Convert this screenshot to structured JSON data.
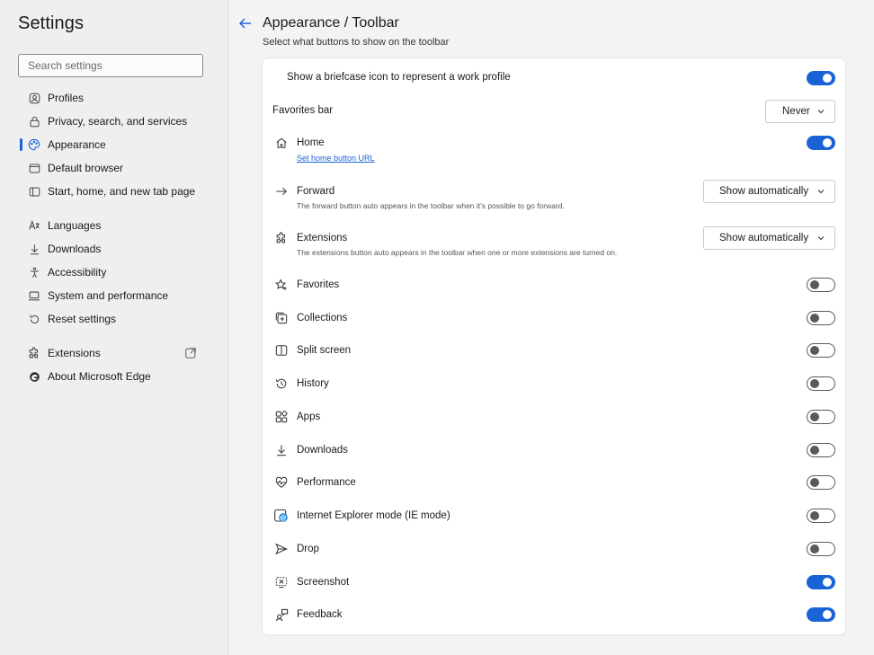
{
  "sidebar": {
    "title": "Settings",
    "search_placeholder": "Search settings",
    "items": [
      {
        "label": "Profiles",
        "icon": "profile-icon"
      },
      {
        "label": "Privacy, search, and services",
        "icon": "lock-icon"
      },
      {
        "label": "Appearance",
        "icon": "palette-icon",
        "active": true
      },
      {
        "label": "Default browser",
        "icon": "browser-icon"
      },
      {
        "label": "Start, home, and new tab page",
        "icon": "home-tab-icon"
      },
      {
        "label": "Languages",
        "icon": "languages-icon"
      },
      {
        "label": "Downloads",
        "icon": "download-icon"
      },
      {
        "label": "Accessibility",
        "icon": "accessibility-icon"
      },
      {
        "label": "System and performance",
        "icon": "laptop-icon"
      },
      {
        "label": "Reset settings",
        "icon": "reset-icon"
      },
      {
        "label": "Extensions",
        "icon": "puzzle-icon"
      },
      {
        "label": "About Microsoft Edge",
        "icon": "edge-logo-icon"
      }
    ]
  },
  "header": {
    "title": "Appearance / Toolbar",
    "subtitle": "Select what buttons to show on the toolbar"
  },
  "settings": {
    "briefcase": {
      "label": "Show a briefcase icon to represent a work profile",
      "toggle": "on"
    },
    "favorites_bar": {
      "label": "Favorites bar",
      "value": "Never"
    },
    "home": {
      "label": "Home",
      "link": "Set home button URL",
      "toggle": "on"
    },
    "forward": {
      "label": "Forward",
      "desc": "The forward button auto appears in the toolbar when it's possible to go forward.",
      "value": "Show automatically"
    },
    "extensions": {
      "label": "Extensions",
      "desc": "The extensions button auto appears in the toolbar when one or more extensions are turned on.",
      "value": "Show automatically"
    },
    "favorites": {
      "label": "Favorites",
      "toggle": "off"
    },
    "collections": {
      "label": "Collections",
      "toggle": "off"
    },
    "split_screen": {
      "label": "Split screen",
      "toggle": "off"
    },
    "history": {
      "label": "History",
      "toggle": "off"
    },
    "apps": {
      "label": "Apps",
      "toggle": "off"
    },
    "downloads": {
      "label": "Downloads",
      "toggle": "off"
    },
    "performance": {
      "label": "Performance",
      "toggle": "off"
    },
    "ie_mode": {
      "label": "Internet Explorer mode (IE mode)",
      "toggle": "off"
    },
    "drop": {
      "label": "Drop",
      "toggle": "off"
    },
    "screenshot": {
      "label": "Screenshot",
      "toggle": "on"
    },
    "feedback": {
      "label": "Feedback",
      "toggle": "on"
    }
  },
  "colors": {
    "accent": "#1a63d6",
    "sidebar_bg": "#efefef",
    "card_bg": "#ffffff"
  }
}
